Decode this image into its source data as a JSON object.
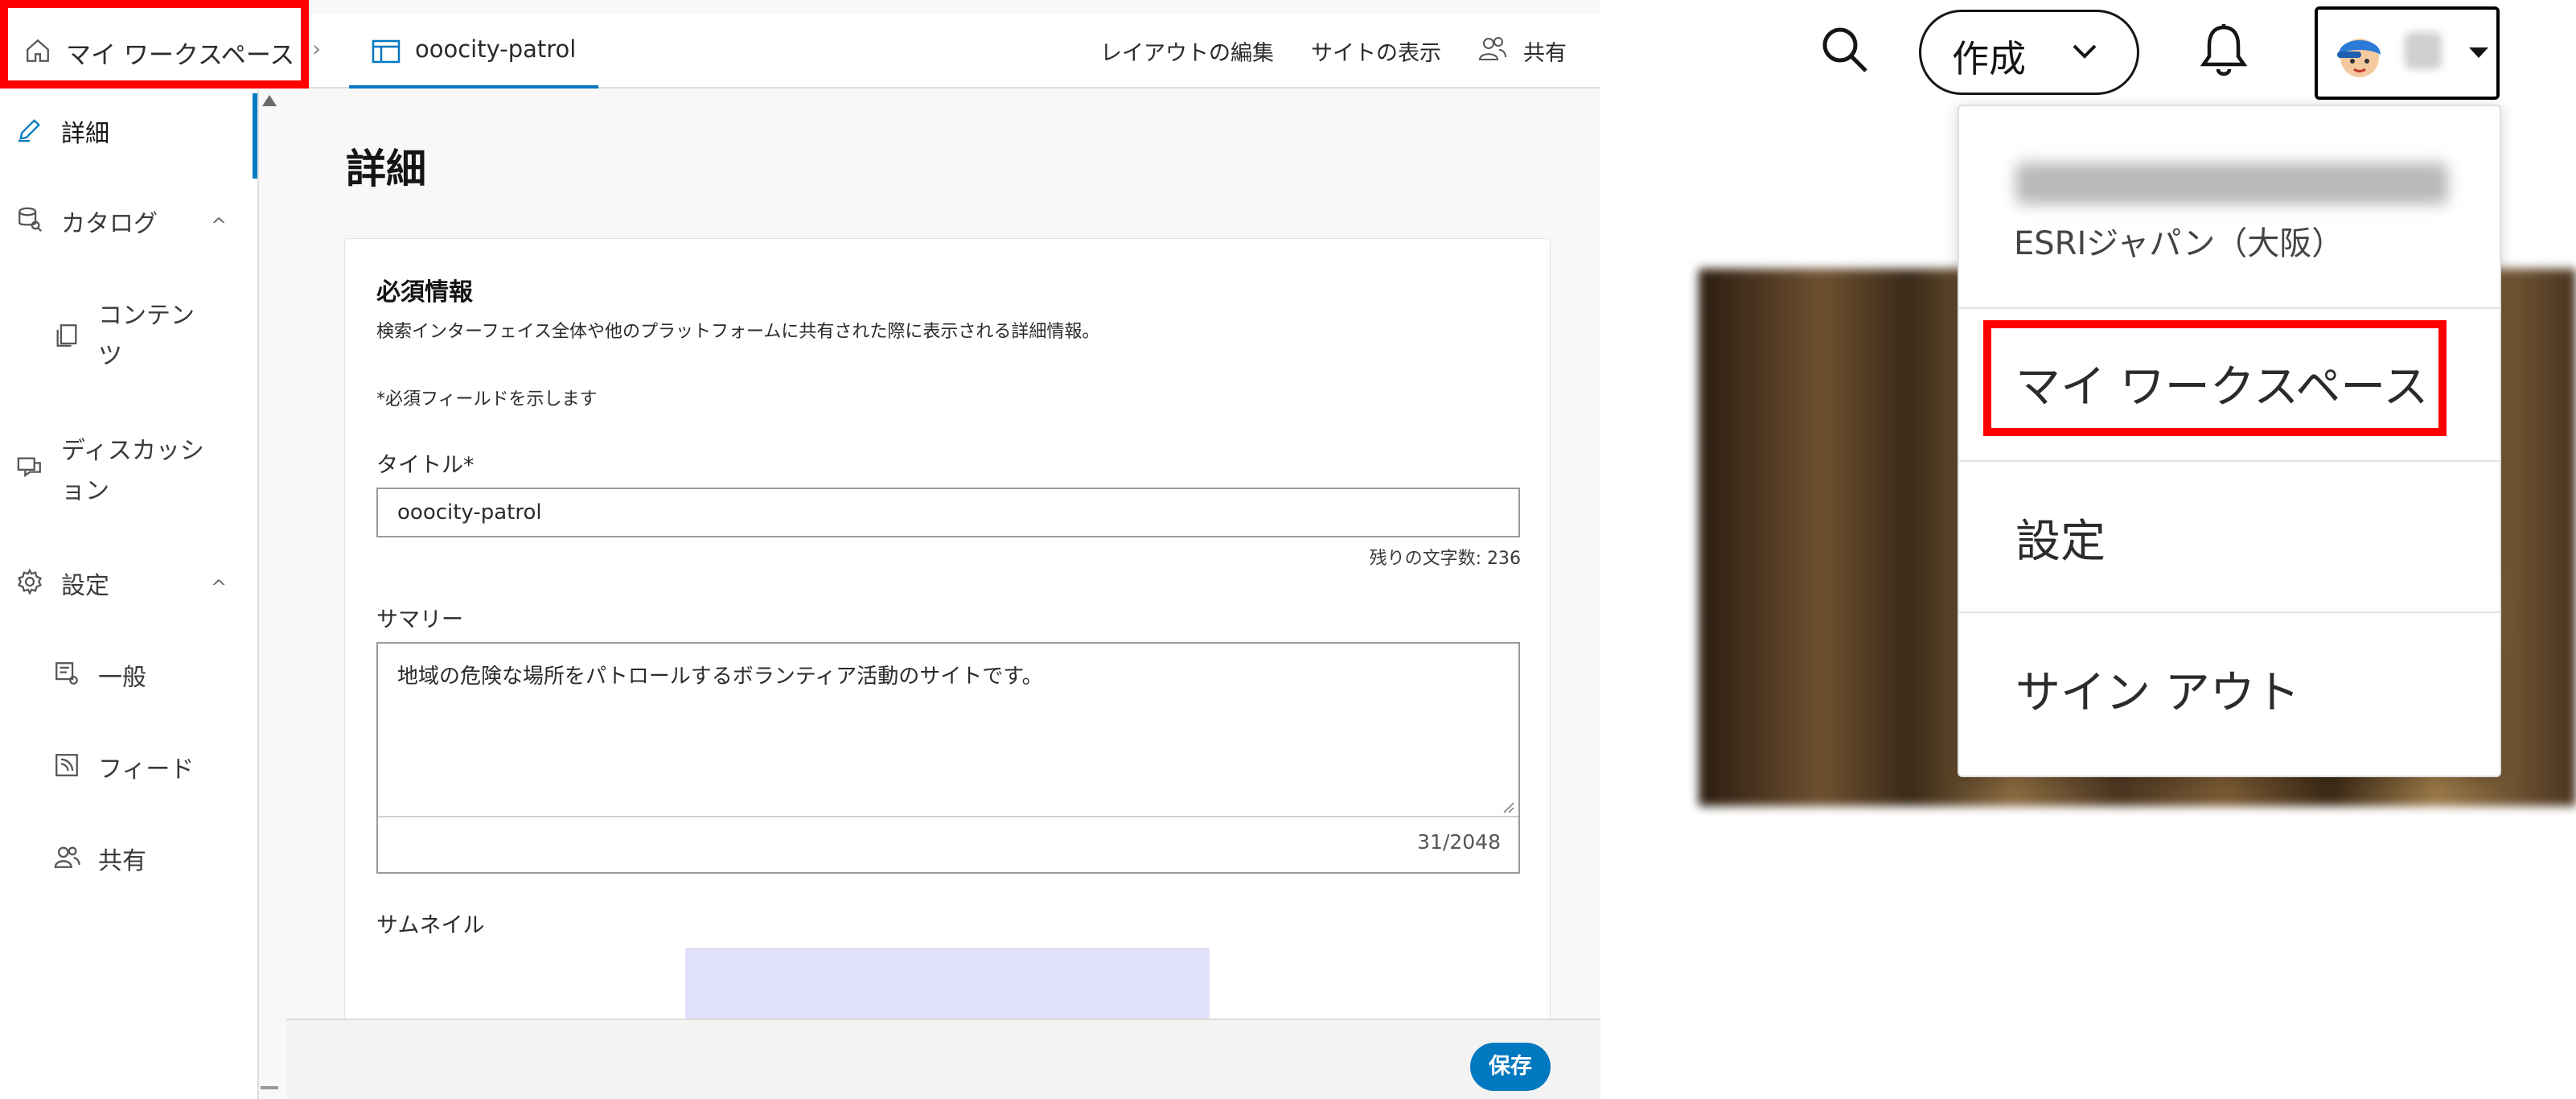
{
  "left_panel": {
    "breadcrumb": {
      "my_workspace": "マイ ワークスペース",
      "separator": "›",
      "site_name": "ooocity-patrol"
    },
    "top_nav": {
      "edit_layout": "レイアウトの編集",
      "view_site": "サイトの表示",
      "share": "共有"
    },
    "sidebar": {
      "items": [
        {
          "label": "詳細",
          "icon": "edit-icon",
          "active": true
        },
        {
          "label": "カタログ",
          "icon": "catalog-icon",
          "expanded": true
        },
        {
          "label": "コンテンツ",
          "icon": "content-icon",
          "child": true
        },
        {
          "label": "ディスカッション",
          "icon": "discussion-icon"
        },
        {
          "label": "設定",
          "icon": "gear-icon",
          "expanded": true
        },
        {
          "label": "一般",
          "icon": "general-icon",
          "child": true
        },
        {
          "label": "フィード",
          "icon": "feed-icon",
          "child": true
        },
        {
          "label": "共有",
          "icon": "share-icon",
          "child": true
        }
      ],
      "caret": "^"
    },
    "main": {
      "page_title": "詳細",
      "section_title": "必須情報",
      "section_desc": "検索インターフェイス全体や他のプラットフォームに共有された際に表示される詳細情報。",
      "required_note": "*必須フィールドを示します",
      "title_label": "タイトル*",
      "title_value": "ooocity-patrol",
      "title_remaining": "残りの文字数: 236",
      "summary_label": "サマリー",
      "summary_value": "地域の危険な場所をパトロールするボランティア活動のサイトです。",
      "summary_count": "31/2048",
      "thumbnail_label": "サムネイル",
      "save_button": "保存"
    }
  },
  "right_panel": {
    "header": {
      "create_button": "作成",
      "icons": [
        "search-icon",
        "bell-icon",
        "avatar-icon",
        "caret-down-icon"
      ]
    },
    "user_menu": {
      "org": "ESRIジャパン（大阪）",
      "items": [
        "マイ ワークスペース",
        "設定",
        "サイン アウト"
      ]
    }
  },
  "colors": {
    "highlight": "#ff0000",
    "accent": "#007ac2",
    "save_button": "#0079c1",
    "thumbnail_placeholder": "#e0e0f8"
  }
}
